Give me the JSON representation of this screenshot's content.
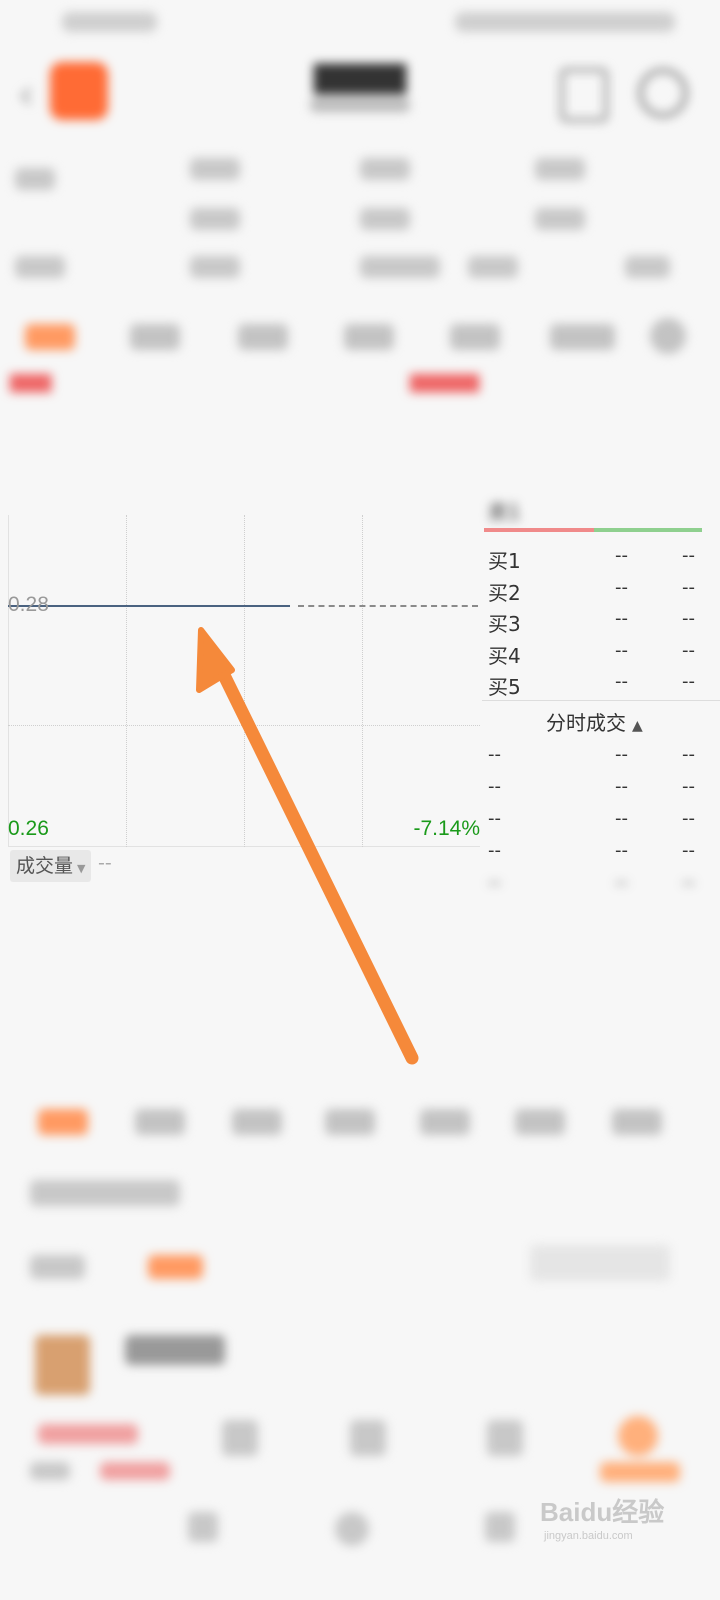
{
  "chart": {
    "price_value": "0.28",
    "low_value": "0.26",
    "low_percent": "-7.14%"
  },
  "volume": {
    "label": "成交量",
    "value": "--"
  },
  "orderbook": {
    "sell_visible_label": "卖1",
    "buy": [
      {
        "label": "买1",
        "price": "--",
        "qty": "--"
      },
      {
        "label": "买2",
        "price": "--",
        "qty": "--"
      },
      {
        "label": "买3",
        "price": "--",
        "qty": "--"
      },
      {
        "label": "买4",
        "price": "--",
        "qty": "--"
      },
      {
        "label": "买5",
        "price": "--",
        "qty": "--"
      }
    ]
  },
  "trades": {
    "title": "分时成交",
    "rows": [
      {
        "time": "--",
        "price": "--",
        "qty": "--"
      },
      {
        "time": "--",
        "price": "--",
        "qty": "--"
      },
      {
        "time": "--",
        "price": "--",
        "qty": "--"
      },
      {
        "time": "--",
        "price": "--",
        "qty": "--"
      },
      {
        "time": "--",
        "price": "--",
        "qty": "--"
      }
    ]
  },
  "watermark": {
    "main": "Baidu经验",
    "sub": "jingyan.baidu.com"
  },
  "colors": {
    "accent": "#ff6b35",
    "arrow": "#f5893a",
    "down": "#1a9a1a",
    "up": "#e66666",
    "price_line": "#4a6280"
  }
}
